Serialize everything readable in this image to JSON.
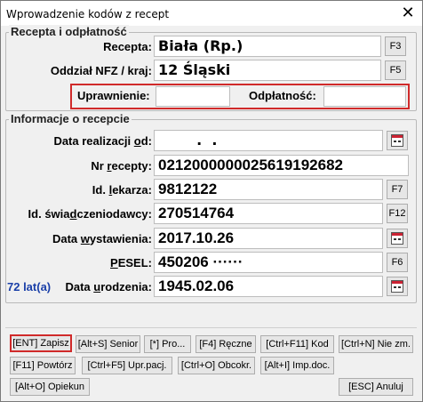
{
  "window": {
    "title": "Wprowadzenie kodów z recept",
    "close_glyph": "✕"
  },
  "recepta_group": {
    "title": "Recepta i odpłatność",
    "recepta_label": "Recepta:",
    "recepta_value": "Biała (Rp.)",
    "recepta_key": "F3",
    "oddzial_label": "Oddział NFZ / kraj:",
    "oddzial_value": "12 Śląski",
    "oddzial_key": "F5",
    "uprawnienie_label": "Uprawnienie:",
    "uprawnienie_value": "",
    "odplatnosc_label": "Odpłatność:",
    "odplatnosc_value": ""
  },
  "info_group": {
    "title": "Informacje o recepcie",
    "data_realizacji_label_pre": "Data realizacji ",
    "data_realizacji_label_ul": "o",
    "data_realizacji_label_post": "d:",
    "data_realizacji_value": "  .  .",
    "nr_recepty_label_pre": "Nr ",
    "nr_recepty_label_ul": "r",
    "nr_recepty_label_post": "ecepty:",
    "nr_recepty_value": "0212000000025619192682",
    "id_lekarza_label_pre": "Id. ",
    "id_lekarza_label_ul": "l",
    "id_lekarza_label_post": "ekarza:",
    "id_lekarza_value": "9812122",
    "id_lekarza_key": "F7",
    "id_swiad_label_pre": "Id. świa",
    "id_swiad_label_ul": "d",
    "id_swiad_label_post": "czeniodawcy:",
    "id_swiad_value": "270514764",
    "id_swiad_key": "F12",
    "data_wyst_label_pre": "Data ",
    "data_wyst_label_ul": "w",
    "data_wyst_label_post": "ystawienia:",
    "data_wyst_value": "2017.10.26",
    "pesel_label_ul": "P",
    "pesel_label_post": "ESEL:",
    "pesel_value": "450206 ······",
    "pesel_key": "F6",
    "age_text": "72 lat(a)",
    "data_ur_label_pre": "Data ",
    "data_ur_label_ul": "u",
    "data_ur_label_post": "rodzenia:",
    "data_ur_value": "1945.02.06"
  },
  "buttons": {
    "zapisz": "[ENT] Zapisz",
    "senior": "[Alt+S] Senior",
    "pro": "[*] Pro...",
    "reczne": "[F4] Ręczne",
    "kod": "[Ctrl+F11] Kod",
    "nie_zm": "[Ctrl+N] Nie zm.",
    "powtorz": "[F11] Powtórz",
    "upr_pacj": "[Ctrl+F5] Upr.pacj.",
    "obcokr": "[Ctrl+O] Obcokr.",
    "imp_doc": "[Alt+I] Imp.doc.",
    "opiekun": "[Alt+O] Opiekun",
    "anuluj": "[ESC] Anuluj"
  },
  "colors": {
    "highlight": "#d02a2a",
    "age": "#1a3fa8"
  },
  "icons": {
    "calendar": "calendar-icon",
    "close": "close-icon"
  }
}
